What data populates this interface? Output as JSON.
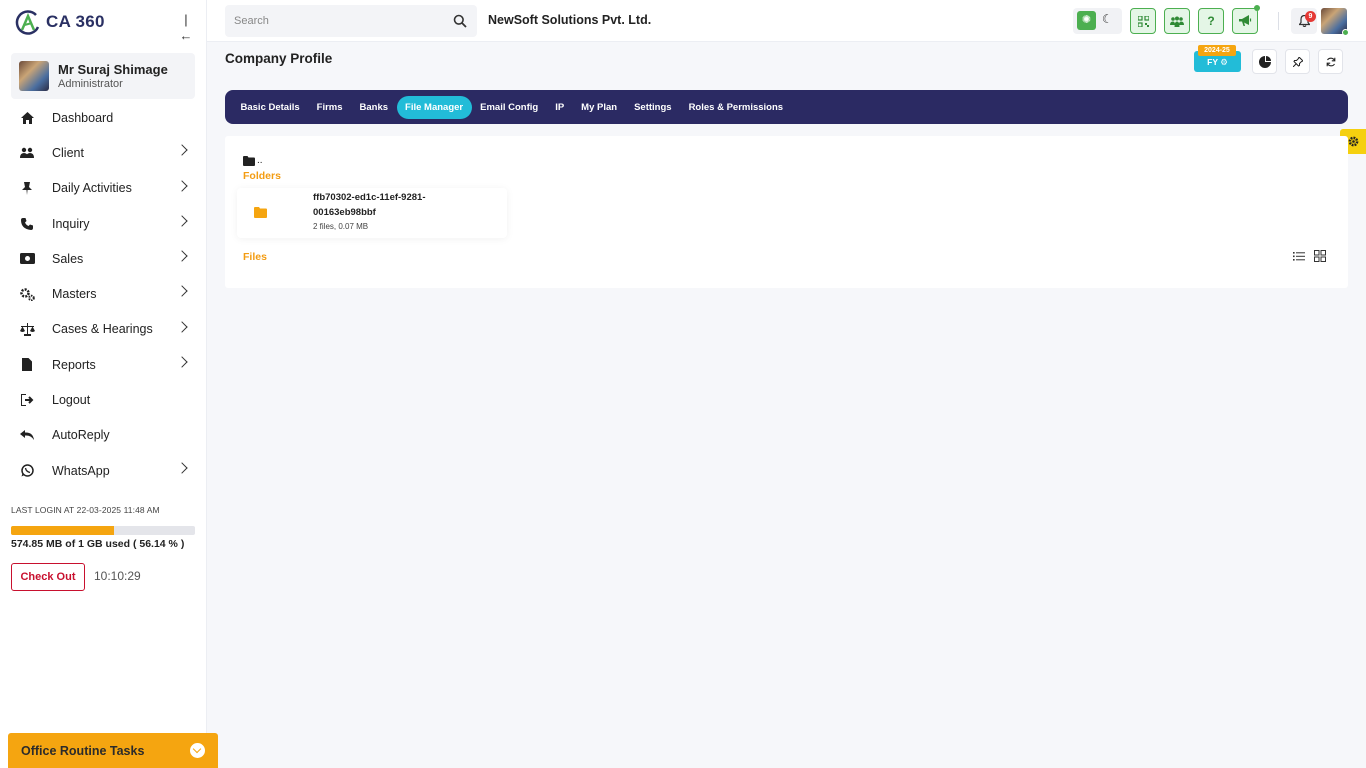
{
  "app": {
    "logo_text": "CA 360"
  },
  "user": {
    "name": "Mr Suraj Shimage",
    "role": "Administrator"
  },
  "sidebar": {
    "items": [
      {
        "label": "Dashboard",
        "icon": "home-icon",
        "has_children": false
      },
      {
        "label": "Client",
        "icon": "users-icon",
        "has_children": true
      },
      {
        "label": "Daily Activities",
        "icon": "pin-icon",
        "has_children": true
      },
      {
        "label": "Inquiry",
        "icon": "phone-icon",
        "has_children": true
      },
      {
        "label": "Sales",
        "icon": "money-icon",
        "has_children": true
      },
      {
        "label": "Masters",
        "icon": "cogs-icon",
        "has_children": true
      },
      {
        "label": "Cases & Hearings",
        "icon": "scale-icon",
        "has_children": true
      },
      {
        "label": "Reports",
        "icon": "file-icon",
        "has_children": true
      },
      {
        "label": "Logout",
        "icon": "logout-icon",
        "has_children": false
      },
      {
        "label": "AutoReply",
        "icon": "reply-icon",
        "has_children": false
      },
      {
        "label": "WhatsApp",
        "icon": "whatsapp-icon",
        "has_children": true
      }
    ],
    "last_login": "LAST LOGIN AT 22-03-2025 11:48 AM",
    "storage": {
      "text": "574.85 MB of 1 GB used ( 56.14 % )",
      "percent": 56.14
    },
    "checkout_label": "Check Out",
    "clock": "10:10:29",
    "routine_label": "Office Routine Tasks"
  },
  "header": {
    "search_placeholder": "Search",
    "company": "NewSoft Solutions Pvt. Ltd.",
    "notification_count": "9"
  },
  "page": {
    "title": "Company Profile",
    "fy_label": "FY",
    "fy_year": "2024-25",
    "tabs": [
      {
        "label": "Basic Details",
        "active": false
      },
      {
        "label": "Firms",
        "active": false
      },
      {
        "label": "Banks",
        "active": false
      },
      {
        "label": "File Manager",
        "active": true
      },
      {
        "label": "Email Config",
        "active": false
      },
      {
        "label": "IP",
        "active": false
      },
      {
        "label": "My Plan",
        "active": false
      },
      {
        "label": "Settings",
        "active": false
      },
      {
        "label": "Roles & Permissions",
        "active": false
      }
    ]
  },
  "file_manager": {
    "parent_dir": "..",
    "folders_label": "Folders",
    "files_label": "Files",
    "folders": [
      {
        "name": "ffb70302-ed1c-11ef-9281-00163eb98bbf",
        "meta": "2 files, 0.07 MB"
      }
    ]
  },
  "colors": {
    "accent": "#f5a510",
    "nav_bg": "#2b2a63",
    "active_tab": "#22bcd8",
    "success": "#4caf50"
  }
}
